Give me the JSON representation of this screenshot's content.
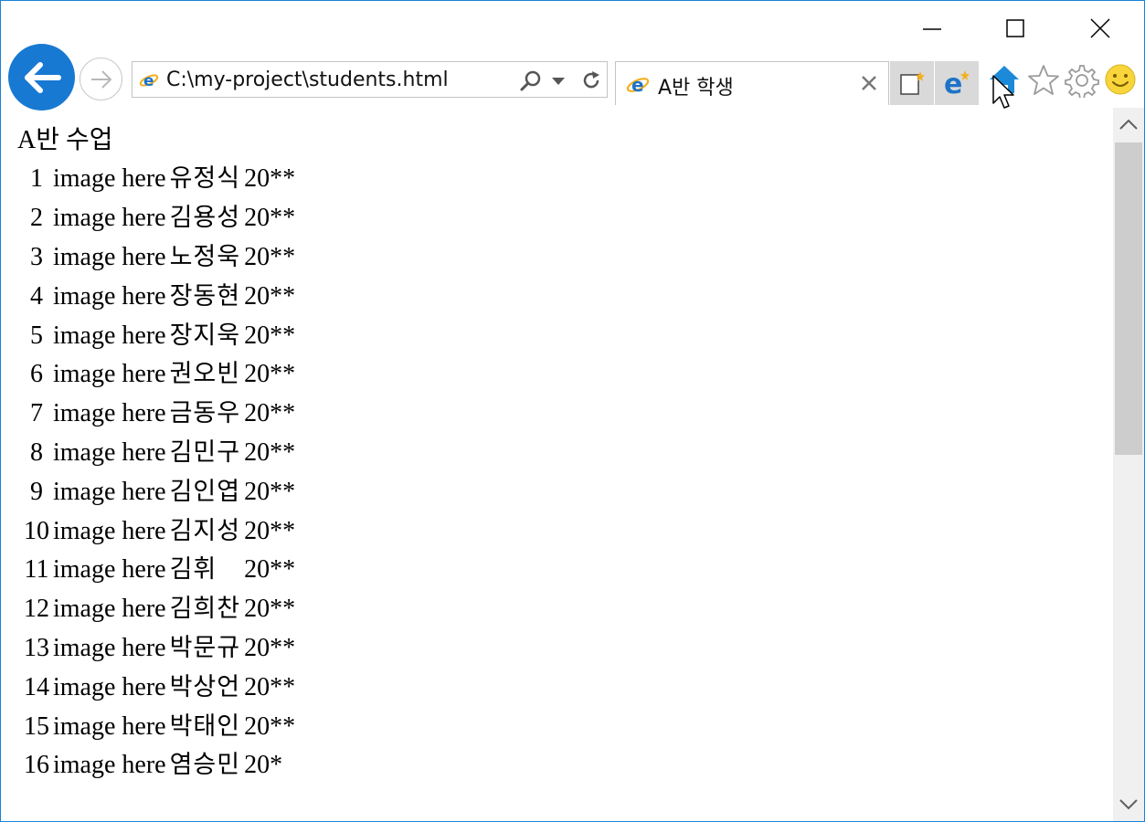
{
  "address_bar": {
    "url": "C:\\my-project\\students.html"
  },
  "tab": {
    "title": "A반 학생"
  },
  "page": {
    "title": "A반 수업",
    "rows": [
      {
        "num": "1",
        "image": "image here",
        "name": "유정식",
        "year": "20**"
      },
      {
        "num": "2",
        "image": "image here",
        "name": "김용성",
        "year": "20**"
      },
      {
        "num": "3",
        "image": "image here",
        "name": "노정욱",
        "year": "20**"
      },
      {
        "num": "4",
        "image": "image here",
        "name": "장동현",
        "year": "20**"
      },
      {
        "num": "5",
        "image": "image here",
        "name": "장지욱",
        "year": "20**"
      },
      {
        "num": "6",
        "image": "image here",
        "name": "권오빈",
        "year": "20**"
      },
      {
        "num": "7",
        "image": "image here",
        "name": "금동우",
        "year": "20**"
      },
      {
        "num": "8",
        "image": "image here",
        "name": "김민구",
        "year": "20**"
      },
      {
        "num": "9",
        "image": "image here",
        "name": "김인엽",
        "year": "20**"
      },
      {
        "num": "10",
        "image": "image here",
        "name": "김지성",
        "year": "20**"
      },
      {
        "num": "11",
        "image": "image here",
        "name": "김휘",
        "year": "20**"
      },
      {
        "num": "12",
        "image": "image here",
        "name": "김희찬",
        "year": "20**"
      },
      {
        "num": "13",
        "image": "image here",
        "name": "박문규",
        "year": "20**"
      },
      {
        "num": "14",
        "image": "image here",
        "name": "박상언",
        "year": "20**"
      },
      {
        "num": "15",
        "image": "image here",
        "name": "박태인",
        "year": "20**"
      },
      {
        "num": "16",
        "image": "image here",
        "name": "염승민",
        "year": "20*"
      }
    ]
  },
  "icons": {
    "back": "back-arrow-icon",
    "forward": "forward-arrow-icon",
    "search": "search-icon",
    "dropdown": "chevron-down-icon",
    "refresh": "refresh-icon",
    "home": "home-icon",
    "favorites": "star-icon",
    "tools": "gear-icon",
    "feedback": "smiley-icon"
  },
  "colors": {
    "window_border": "#1883d7",
    "back_button": "#1779d2",
    "ie_blue": "#1e73c8",
    "ie_gold": "#f2b01e",
    "home_blue": "#1c8ad8",
    "smiley": "#f7d53b"
  }
}
